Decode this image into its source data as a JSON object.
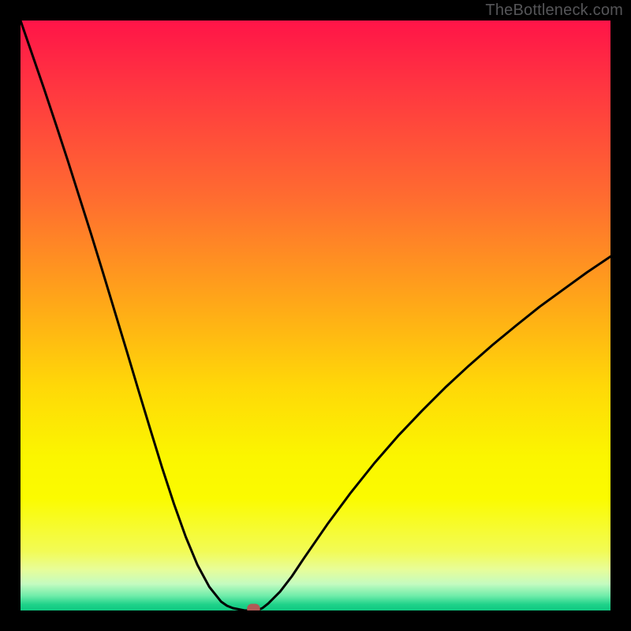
{
  "watermark": {
    "text": "TheBottleneck.com"
  },
  "chart_data": {
    "type": "line",
    "title": "",
    "xlabel": "",
    "ylabel": "",
    "xlim": [
      0,
      100
    ],
    "ylim": [
      0,
      100
    ],
    "grid": false,
    "legend": false,
    "x": [
      0,
      2,
      4,
      6,
      8,
      10,
      12,
      14,
      16,
      18,
      20,
      22,
      24,
      26,
      28,
      30,
      32,
      34,
      35,
      36,
      37,
      38,
      39,
      40,
      41,
      42,
      44,
      46,
      48,
      52,
      56,
      60,
      64,
      68,
      72,
      76,
      80,
      84,
      88,
      92,
      96,
      100
    ],
    "values": [
      100,
      94.2,
      88.4,
      82.4,
      76.3,
      70.0,
      63.7,
      57.2,
      50.6,
      44.0,
      37.3,
      30.7,
      24.2,
      18.1,
      12.5,
      7.7,
      4.0,
      1.5,
      0.8,
      0.4,
      0.2,
      0,
      0,
      0,
      0.4,
      1.2,
      3.2,
      5.8,
      8.8,
      14.6,
      20.0,
      25.0,
      29.6,
      33.8,
      37.8,
      41.5,
      45.0,
      48.3,
      51.5,
      54.4,
      57.3,
      60.0
    ],
    "marker": {
      "x_center": 39.5,
      "y": 0,
      "width": 2.2,
      "color": "#b15a56"
    },
    "gradient_stops": [
      {
        "offset": 0.0,
        "color": "#ff1448"
      },
      {
        "offset": 0.12,
        "color": "#ff3840"
      },
      {
        "offset": 0.3,
        "color": "#ff6c30"
      },
      {
        "offset": 0.48,
        "color": "#ffa818"
      },
      {
        "offset": 0.62,
        "color": "#ffd808"
      },
      {
        "offset": 0.74,
        "color": "#fbf600"
      },
      {
        "offset": 0.81,
        "color": "#fbfb00"
      },
      {
        "offset": 0.9,
        "color": "#f2fb56"
      },
      {
        "offset": 0.93,
        "color": "#e8fd98"
      },
      {
        "offset": 0.955,
        "color": "#c4fbc0"
      },
      {
        "offset": 0.975,
        "color": "#70ecaa"
      },
      {
        "offset": 0.99,
        "color": "#1ed289"
      },
      {
        "offset": 1.0,
        "color": "#10c982"
      }
    ]
  }
}
